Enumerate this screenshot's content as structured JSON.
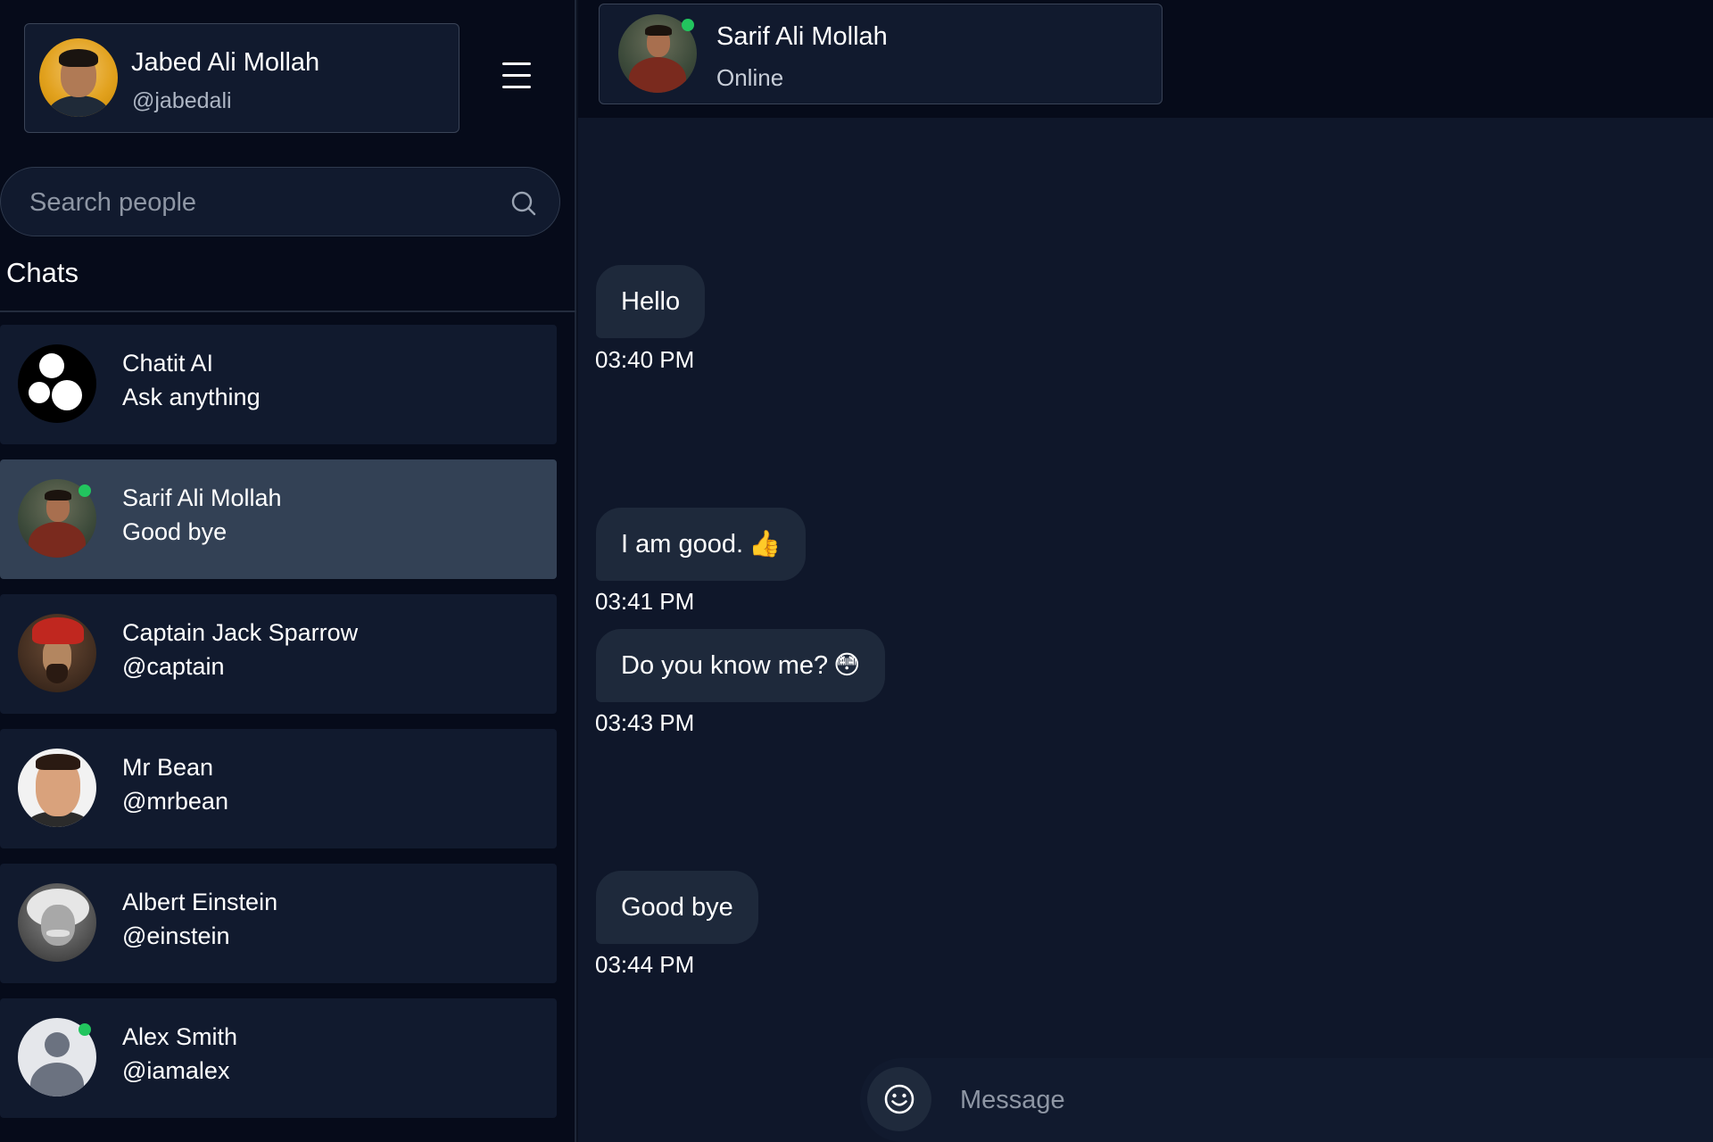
{
  "current_user": {
    "name": "Jabed Ali Mollah",
    "handle": "@jabedali"
  },
  "search": {
    "placeholder": "Search people"
  },
  "sidebar": {
    "chats_title": "Chats",
    "chats": [
      {
        "name": "Chatit AI",
        "subtitle": "Ask anything",
        "avatar": "chatit-ai-logo",
        "online": false,
        "active": false
      },
      {
        "name": "Sarif Ali Mollah",
        "subtitle": "Good bye",
        "avatar": "photo",
        "online": true,
        "active": true
      },
      {
        "name": "Captain Jack Sparrow",
        "subtitle": "@captain",
        "avatar": "photo",
        "online": false,
        "active": false
      },
      {
        "name": "Mr Bean",
        "subtitle": "@mrbean",
        "avatar": "photo",
        "online": false,
        "active": false
      },
      {
        "name": "Albert Einstein",
        "subtitle": "@einstein",
        "avatar": "photo",
        "online": false,
        "active": false
      },
      {
        "name": "Alex Smith",
        "subtitle": "@iamalex",
        "avatar": "default-user-icon",
        "online": true,
        "active": false
      }
    ]
  },
  "conversation": {
    "contact_name": "Sarif Ali Mollah",
    "status": "Online",
    "messages": [
      {
        "text": "Hello",
        "emoji": "",
        "time": "03:40 PM"
      },
      {
        "text": "I am good.",
        "emoji": "👍",
        "time": "03:41 PM"
      },
      {
        "text": "Do you know me?",
        "emoji": "😳",
        "time": "03:43 PM"
      },
      {
        "text": "Good bye",
        "emoji": "",
        "time": "03:44 PM"
      }
    ]
  },
  "composer": {
    "placeholder": "Message",
    "emoji_icon": "smiley-icon"
  },
  "colors": {
    "sidebar_bg": "#060b1a",
    "panel_bg": "#0f172a",
    "card_bg": "#111a2e",
    "active_chat_bg": "#334155",
    "bubble_bg": "#1e293b",
    "online": "#22c55e"
  }
}
